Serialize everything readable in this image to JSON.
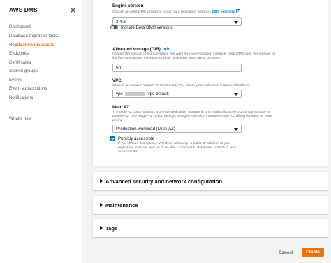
{
  "sidebar": {
    "title": "AWS DMS",
    "items": [
      {
        "label": "Dashboard",
        "active": false
      },
      {
        "label": "Database migration tasks",
        "active": false
      },
      {
        "label": "Replication instances",
        "active": true
      },
      {
        "label": "Endpoints",
        "active": false
      },
      {
        "label": "Certificates",
        "active": false
      },
      {
        "label": "Subnet groups",
        "active": false
      },
      {
        "label": "Events",
        "active": false
      },
      {
        "label": "Event subscriptions",
        "active": false
      },
      {
        "label": "Notifications",
        "active": false
      }
    ],
    "whats_new": "What's new"
  },
  "engine": {
    "label": "Engine version",
    "desc": "Choose an AWS DMS version to run on your replication instance.",
    "link": "DMS versions",
    "value": "3.4.6",
    "beta_toggle_label": "Include Beta DMS versions",
    "beta_toggle_on": false
  },
  "storage": {
    "label": "Allocated storage (GiB)",
    "info": "Info",
    "desc_line1": "Choose the amount of storage space you want for your replication instance. AWS DMS uses this storage for",
    "desc_line2": "log files and cached transactions while replication tasks are in progress.",
    "value": "50"
  },
  "vpc": {
    "label": "VPC",
    "desc": "Choose an Amazon Virtual Private Cloud (VPC) where your replication instance should run.",
    "value_prefix": "vpc-",
    "value_suffix": "- vpc-default"
  },
  "multi_az": {
    "label": "Multi AZ",
    "desc_line1": "The Multi-AZ option deploys a primary replication instance in one Availability Zone (AZ) and a standby in",
    "desc_line2": "another AZ. The Single-AZ option deploys a single replication instance in one AZ. Billing is based on DMS",
    "desc_line3": "pricing.",
    "value": "Production workload (Multi-AZ)"
  },
  "public": {
    "label": "Publicly accessible",
    "checked": true,
    "desc": "If you choose this option, AWS DMS will assign a public IP address to your replication instance, and you'll be able to connect to databases outside of your Amazon VPC."
  },
  "sections": [
    {
      "label": "Advanced security and network configuration"
    },
    {
      "label": "Maintenance"
    },
    {
      "label": "Tags"
    }
  ],
  "footer": {
    "cancel": "Cancel",
    "create": "Create"
  },
  "colors": {
    "accent": "#ec7211",
    "link": "#0073bb"
  }
}
